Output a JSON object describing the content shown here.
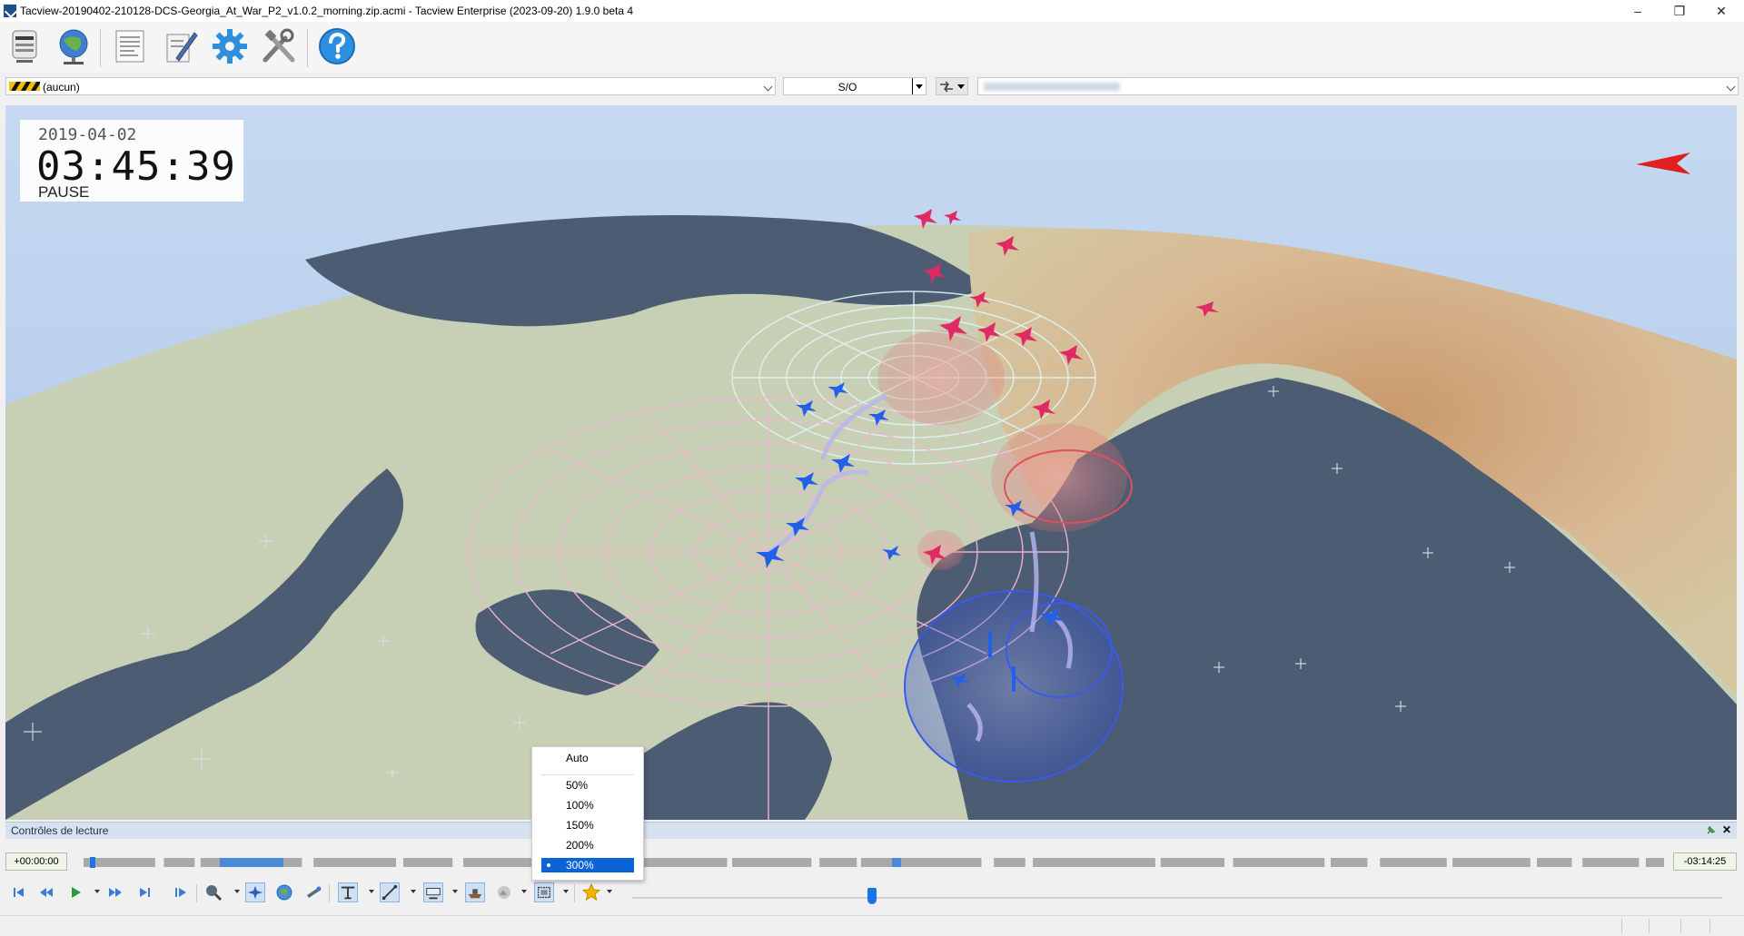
{
  "window": {
    "title": "Tacview-20190402-210128-DCS-Georgia_At_War_P2_v1.0.2_morning.zip.acmi - Tacview Enterprise (2023-09-20) 1.9.0 beta 4",
    "minimize_glyph": "–",
    "maximize_glyph": "❐",
    "close_glyph": "✕"
  },
  "toolbar": {
    "icons": [
      "storage-icon",
      "globe-network-icon",
      "document-icon",
      "edit-pen-icon",
      "gear-icon",
      "tools-icon",
      "help-icon"
    ]
  },
  "selection_bar": {
    "object_combo": "(aucun)",
    "relative_combo": "S/O"
  },
  "hud": {
    "date": "2019-04-02",
    "time": "03:45:39",
    "state": "PAUSE"
  },
  "popup_menu": {
    "items": [
      "Auto",
      "50%",
      "100%",
      "150%",
      "200%",
      "300%"
    ],
    "selected": "300%"
  },
  "panel": {
    "title": "Contrôles de lecture"
  },
  "timeline": {
    "start_time": "+00:00:00",
    "end_time": "-03:14:25",
    "position": 0.004
  },
  "playback": {
    "speed_slider_position": 0.22
  },
  "colors": {
    "sea": "#4a5a6e",
    "land": "#c8d0b4",
    "mountains": "#d9b28a",
    "sky": "#bfd4ee",
    "blue_coalition": "#1f62e0",
    "red_coalition": "#e0245e",
    "accent": "#0a64d8"
  }
}
